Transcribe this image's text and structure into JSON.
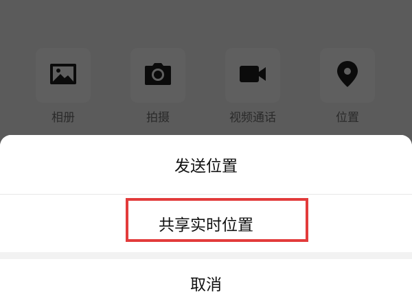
{
  "attachments": [
    {
      "label": "相册",
      "icon": "photo-album-icon"
    },
    {
      "label": "拍摄",
      "icon": "camera-icon"
    },
    {
      "label": "视频通话",
      "icon": "video-call-icon"
    },
    {
      "label": "位置",
      "icon": "location-pin-icon"
    }
  ],
  "sheet": {
    "send_location": "发送位置",
    "share_live_location": "共享实时位置",
    "cancel": "取消"
  },
  "colors": {
    "dim_overlay": "#5b5b5b",
    "highlight_border": "#e23b3b",
    "sheet_background": "#ffffff"
  }
}
